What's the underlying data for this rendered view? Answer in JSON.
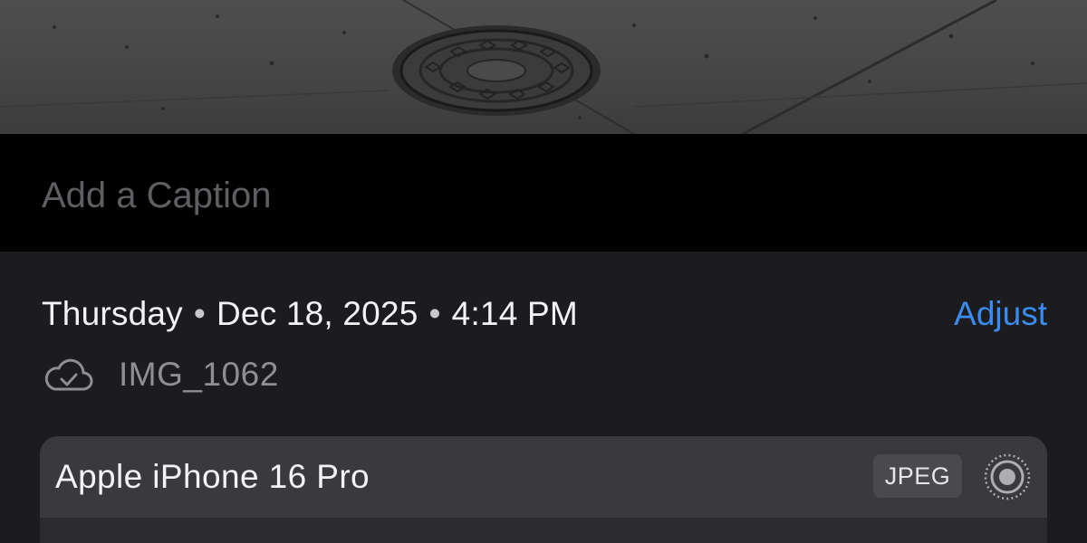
{
  "caption": {
    "placeholder": "Add a Caption"
  },
  "info": {
    "day": "Thursday",
    "date": "Dec 18, 2025",
    "time": "4:14 PM",
    "separator": "•",
    "adjust_label": "Adjust",
    "filename": "IMG_1062",
    "cloud_icon": "icloud-icon"
  },
  "device": {
    "name": "Apple iPhone 16 Pro",
    "format": "JPEG",
    "live_icon": "live-photo-icon"
  },
  "colors": {
    "accent": "#3a8cf1",
    "background": "#1c1c1e",
    "caption_background": "#000000",
    "card_header": "#3a3a3c"
  }
}
